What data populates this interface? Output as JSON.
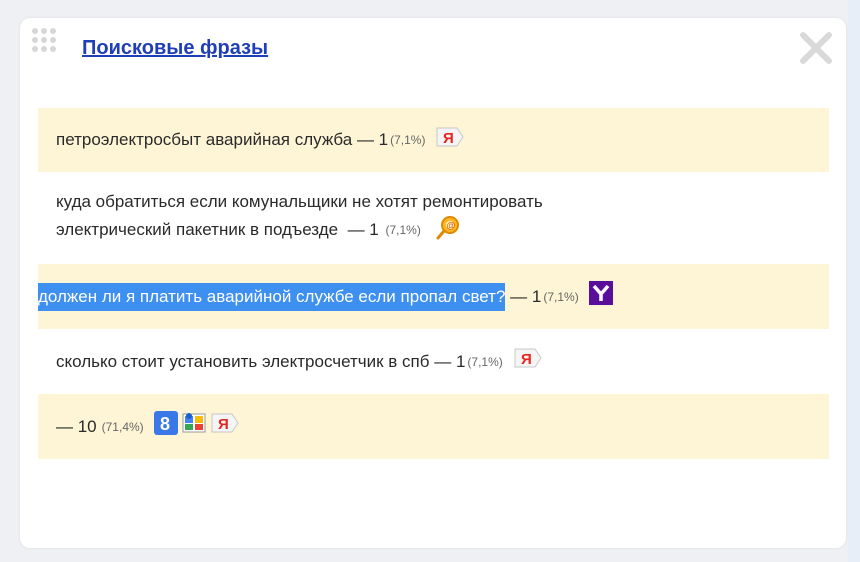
{
  "widget": {
    "title": "Поисковые фразы"
  },
  "phrases": [
    {
      "text": "петроэлектросбыт аварийная служба",
      "count": "— 1",
      "percent": "(7,1%)",
      "engine": "yandex-icon"
    },
    {
      "text_line1": "куда обратиться если комунальщики не хотят ремонтировать",
      "text_line2": "электрический пакетник в подъезде",
      "count": "— 1",
      "percent": "(7,1%)",
      "engine": "mail-ru-search-icon"
    },
    {
      "text": "должен ли я платить аварийной службе если пропал свет?",
      "count": "— 1",
      "percent": "(7,1%)",
      "engine": "yahoo-icon",
      "selected": true
    },
    {
      "text": "сколько стоит установить электросчетчик в спб",
      "count": "— 1",
      "percent": "(7,1%)",
      "engine": "yandex-icon"
    },
    {
      "text": "",
      "count": "— 10",
      "percent": "(71,4%)",
      "engines": [
        "google-icon",
        "google-images-icon",
        "yandex-icon"
      ]
    }
  ],
  "colors": {
    "row_alt_bg": "#fdf5d5",
    "title_link": "#1f3fb8",
    "selection": "#3d8ff0",
    "yahoo": "#5a0f9b",
    "google_blue": "#3b78e7",
    "yandex_red": "#e52620"
  }
}
